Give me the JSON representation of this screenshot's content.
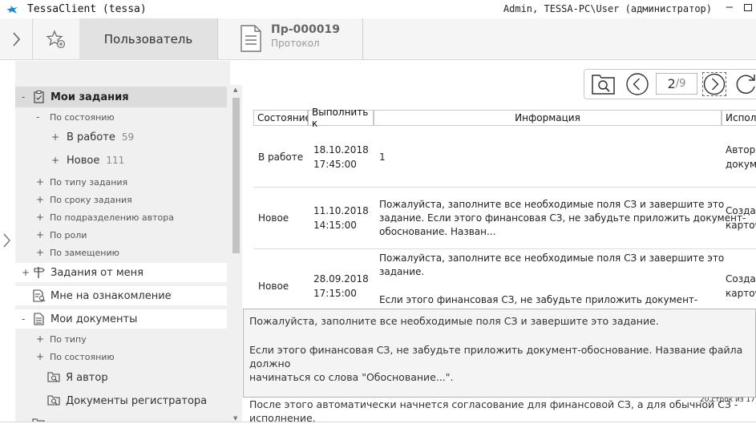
{
  "window": {
    "title": "TessaClient (tessa)",
    "user": "Admin, TESSA-PC\\User (администратор)"
  },
  "tabs": {
    "user_tab": "Пользователь",
    "doc_tab_title": "Пр-000019",
    "doc_tab_subtitle": "Протокол"
  },
  "sidebar": {
    "items": [
      {
        "label": "Мои задания",
        "expander": "-"
      },
      {
        "label": "По состоянию",
        "expander": "-"
      },
      {
        "label": "В работе",
        "count": "59",
        "expander": "+"
      },
      {
        "label": "Новое",
        "count": "111",
        "expander": "+"
      },
      {
        "label": "По типу задания",
        "expander": "+"
      },
      {
        "label": "По сроку задания",
        "expander": "+"
      },
      {
        "label": "По подразделению автора",
        "expander": "+"
      },
      {
        "label": "По роли",
        "expander": "+"
      },
      {
        "label": "По замещению",
        "expander": "+"
      },
      {
        "label": "Задания от меня",
        "expander": "+"
      },
      {
        "label": "Мне на ознакомление",
        "expander": ""
      },
      {
        "label": "Мои документы",
        "expander": "-"
      },
      {
        "label": "По типу",
        "expander": "+"
      },
      {
        "label": "По состоянию",
        "expander": "+"
      },
      {
        "label": "Я автор",
        "expander": ""
      },
      {
        "label": "Документы регистратора",
        "expander": ""
      }
    ]
  },
  "toolbar": {
    "page_current": "2",
    "page_sep": "/",
    "page_total": "9"
  },
  "table": {
    "columns": [
      "Состояние",
      "Выполнить к",
      "Информация",
      "Испол"
    ],
    "rows": [
      {
        "state": "В работе",
        "due_date": "18.10.2018",
        "due_time": "17:45:00",
        "info": [
          "1"
        ],
        "extra": [
          "Автор",
          "докум"
        ]
      },
      {
        "state": "Новое",
        "due_date": "11.10.2018",
        "due_time": "14:15:00",
        "info": [
          "Пожалуйста, заполните все необходимые поля СЗ и завершите это",
          "задание. Если этого финансовая СЗ, не забудьте приложить документ-",
          "обоснование. Назван..."
        ],
        "extra": [
          "Созда",
          "карточ"
        ]
      },
      {
        "state": "Новое",
        "due_date": "28.09.2018",
        "due_time": "17:15:00",
        "info": [
          "Пожалуйста, заполните все необходимые поля СЗ и завершите это",
          "задание.",
          "",
          "Если этого финансовая СЗ, не забудьте приложить документ-"
        ],
        "extra": [
          "Созда",
          "карточ"
        ]
      }
    ]
  },
  "tooltip": {
    "p1": "Пожалуйста, заполните все необходимые поля СЗ и завершите это задание.",
    "p2a": "Если этого финансовая СЗ, не забудьте приложить документ-обоснование. Название файла должно",
    "p2b": "начинаться со слова \"Обоснование...\".",
    "p3": "После этого автоматически начнется согласование для финансовой СЗ, а для обычной СЗ - исполнение."
  },
  "status": {
    "row_count": "20 строк из 17"
  }
}
